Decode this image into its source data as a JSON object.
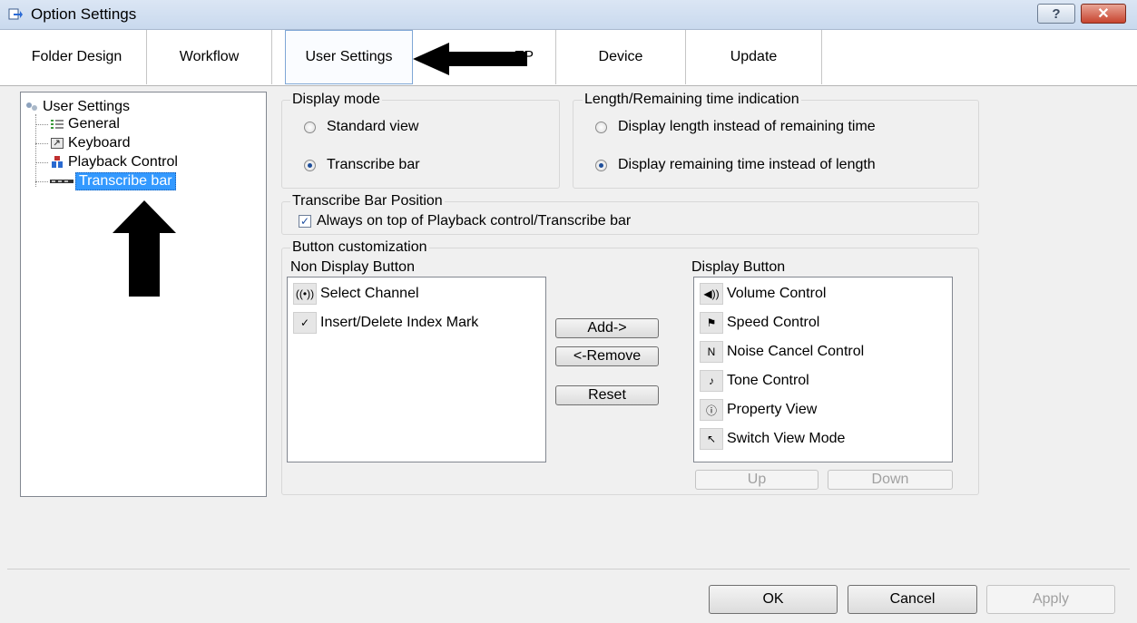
{
  "window": {
    "title": "Option Settings",
    "help_glyph": "?",
    "close_glyph": "✕"
  },
  "tabs": [
    {
      "label": "Folder Design"
    },
    {
      "label": "Workflow"
    },
    {
      "label": "User Settings"
    },
    {
      "label": "FTP",
      "visible": "TP"
    },
    {
      "label": "Device"
    },
    {
      "label": "Update"
    }
  ],
  "tree": {
    "root": "User Settings",
    "items": [
      "General",
      "Keyboard",
      "Playback Control",
      "Transcribe bar"
    ],
    "selected": "Transcribe bar"
  },
  "display_mode": {
    "title": "Display mode",
    "options": [
      "Standard view",
      "Transcribe bar"
    ],
    "selected": "Transcribe bar"
  },
  "length_indication": {
    "title": "Length/Remaining time indication",
    "options": [
      "Display length instead of remaining time",
      "Display remaining time instead of length"
    ],
    "selected": "Display remaining time instead of length"
  },
  "transcribe_position": {
    "title": "Transcribe Bar Position",
    "checkbox_label": "Always on top of Playback control/Transcribe bar",
    "checked": true
  },
  "customization": {
    "title": "Button customization",
    "non_display_title": "Non Display Button",
    "display_title": "Display Button",
    "non_display_items": [
      "Select Channel",
      "Insert/Delete Index Mark"
    ],
    "display_items": [
      "Volume Control",
      "Speed Control",
      "Noise Cancel Control",
      "Tone Control",
      "Property View",
      "Switch View Mode"
    ],
    "add_label": "Add->",
    "remove_label": "<-Remove",
    "reset_label": "Reset",
    "up_label": "Up",
    "down_label": "Down"
  },
  "footer": {
    "ok": "OK",
    "cancel": "Cancel",
    "apply": "Apply"
  },
  "colors": {
    "selection": "#3399ff",
    "title_bar": "#c9d9ee",
    "close_button": "#c7442f"
  }
}
